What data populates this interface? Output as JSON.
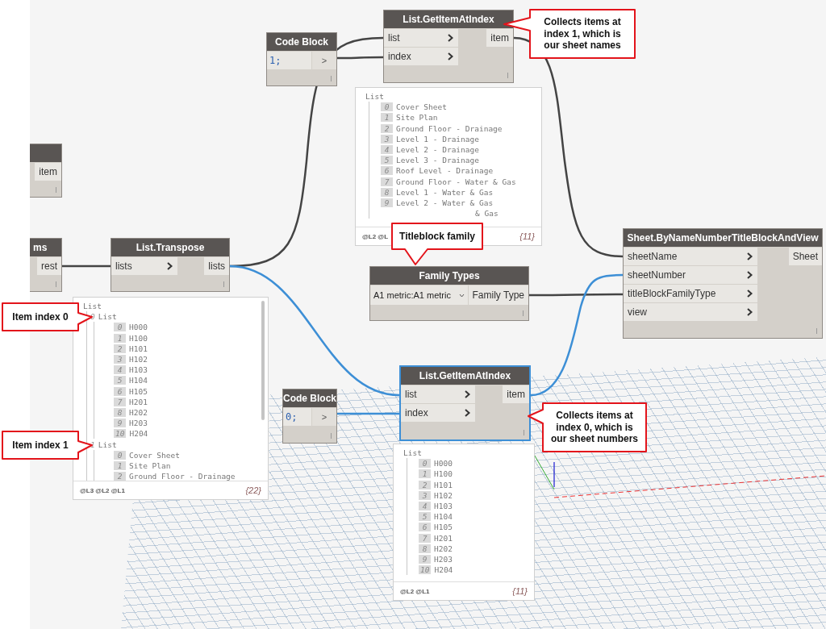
{
  "nodes": [
    {
      "kind": "function",
      "title": "List.GetItemAtIndex",
      "inputs": [
        "list",
        "index"
      ],
      "outputs": [
        "item"
      ],
      "selected": false
    },
    {
      "kind": "code_block",
      "title": "Code Block",
      "code": "1;",
      "outputs": [
        ">"
      ],
      "selected": false
    },
    {
      "kind": "function",
      "outputs": [
        "item"
      ],
      "selected": false
    },
    {
      "kind": "function",
      "title": "Sheet.ByNameNumberTitleBlockAndView",
      "inputs": [
        "sheetName",
        "sheetNumber",
        "titleBlockFamilyType",
        "view"
      ],
      "outputs": [
        "Sheet"
      ],
      "selected": false
    },
    {
      "kind": "function",
      "title": "ms",
      "outputs": [
        "rest"
      ],
      "selected": false
    },
    {
      "kind": "function",
      "title": "List.Transpose",
      "inputs": [
        "lists"
      ],
      "outputs": [
        "lists"
      ],
      "selected": false
    },
    {
      "kind": "dropdown",
      "title": "Family Types",
      "value": "A1 metric:A1 metric",
      "outputs": [
        "Family Type"
      ],
      "selected": false
    },
    {
      "kind": "function",
      "title": "List.GetItemAtIndex",
      "inputs": [
        "list",
        "index"
      ],
      "outputs": [
        "item"
      ],
      "selected": true
    },
    {
      "kind": "code_block",
      "title": "Code Block",
      "code": "0;",
      "outputs": [
        ">"
      ],
      "selected": false
    }
  ],
  "previews": [
    {
      "title": "List",
      "items": [
        {
          "index": "0",
          "text": "Cover Sheet"
        },
        {
          "index": "1",
          "text": "Site Plan"
        },
        {
          "index": "2",
          "text": "Ground Floor - Drainage"
        },
        {
          "index": "3",
          "text": "Level 1 - Drainage"
        },
        {
          "index": "4",
          "text": "Level 2 - Drainage"
        },
        {
          "index": "5",
          "text": "Level 3 - Drainage"
        },
        {
          "index": "6",
          "text": "Roof Level - Drainage"
        },
        {
          "index": "7",
          "text": "Ground Floor - Water & Gas"
        },
        {
          "index": "8",
          "text": "Level 1 - Water & Gas"
        },
        {
          "index": "9",
          "text": "Level 2 - Water & Gas"
        },
        {
          "text": "& Gas"
        }
      ],
      "levels": "@L2 @L",
      "count": "{11}"
    },
    {
      "title": "List",
      "items": [
        {
          "index": "0",
          "text": "List",
          "children": [
            {
              "index": "0",
              "text": "H000"
            },
            {
              "index": "1",
              "text": "H100"
            },
            {
              "index": "2",
              "text": "H101"
            },
            {
              "index": "3",
              "text": "H102"
            },
            {
              "index": "4",
              "text": "H103"
            },
            {
              "index": "5",
              "text": "H104"
            },
            {
              "index": "6",
              "text": "H105"
            },
            {
              "index": "7",
              "text": "H201"
            },
            {
              "index": "8",
              "text": "H202"
            },
            {
              "index": "9",
              "text": "H203"
            },
            {
              "index": "10",
              "text": "H204"
            }
          ]
        },
        {
          "index": "1",
          "text": "List",
          "children": [
            {
              "index": "0",
              "text": "Cover Sheet"
            },
            {
              "index": "1",
              "text": "Site Plan"
            },
            {
              "index": "2",
              "text": "Ground Floor - Drainage"
            }
          ]
        }
      ],
      "levels": "@L3 @L2 @L1",
      "count": "{22}"
    },
    {
      "title": "List",
      "items": [
        {
          "index": "0",
          "text": "H000"
        },
        {
          "index": "1",
          "text": "H100"
        },
        {
          "index": "2",
          "text": "H101"
        },
        {
          "index": "3",
          "text": "H102"
        },
        {
          "index": "4",
          "text": "H103"
        },
        {
          "index": "5",
          "text": "H104"
        },
        {
          "index": "6",
          "text": "H105"
        },
        {
          "index": "7",
          "text": "H201"
        },
        {
          "index": "8",
          "text": "H202"
        },
        {
          "index": "9",
          "text": "H203"
        },
        {
          "index": "10",
          "text": "H204"
        }
      ],
      "levels": "@L2 @L1",
      "count": "{11}"
    }
  ],
  "callouts": [
    {
      "text": "Collects items at index 1, which is our sheet names"
    },
    {
      "text": "Titleblock family"
    },
    {
      "text": "Item index 0"
    },
    {
      "text": "Item index 1"
    },
    {
      "text": "Collects items at index 0, which is our sheet numbers"
    }
  ]
}
